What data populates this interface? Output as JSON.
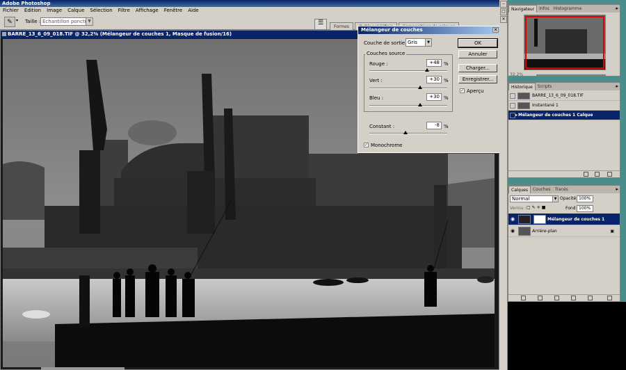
{
  "app": {
    "title": "Adobe Photoshop"
  },
  "menu": [
    "Fichier",
    "Edition",
    "Image",
    "Calque",
    "Sélection",
    "Filtre",
    "Affichage",
    "Fenêtre",
    "Aide"
  ],
  "options": {
    "size_label": "Taille :",
    "size_value": "Echantillon ponctuel"
  },
  "wells": {
    "tabs": [
      "Formes",
      "Outils prédéfinis",
      "Compositions de calques"
    ]
  },
  "document": {
    "title": "BARRE_13_6_09_018.TIF @ 32,2% (Mélangeur de couches 1, Masque de fusion/16)"
  },
  "dialog": {
    "title": "Mélangeur de couches",
    "output_label": "Couche de sortie :",
    "output_value": "Gris",
    "sources_label": "Couches source",
    "sources": [
      {
        "label": "Rouge :",
        "value": "+48",
        "unit": "%",
        "level": 0.74
      },
      {
        "label": "Vert :",
        "value": "+30",
        "unit": "%",
        "level": 0.65
      },
      {
        "label": "Bleu :",
        "value": "+30",
        "unit": "%",
        "level": 0.65
      }
    ],
    "constant": {
      "label": "Constant :",
      "value": "-8",
      "unit": "%",
      "level": 0.46
    },
    "mono_label": "Monochrome",
    "mono_checked": true,
    "buttons": {
      "ok": "OK",
      "cancel": "Annuler",
      "load": "Charger...",
      "save": "Enregistrer..."
    },
    "preview_label": "Aperçu",
    "preview_checked": true
  },
  "navigator": {
    "tabs": [
      "Navigateur",
      "Infos",
      "Histogramme"
    ],
    "zoom": "32,2%"
  },
  "history": {
    "tabs": [
      "Historique",
      "Scripts"
    ],
    "items": [
      {
        "label": "BARRE_13_6_09_018.TIF",
        "selected": false
      },
      {
        "label": "Instantané 1",
        "selected": false
      },
      {
        "label": "Mélangeur de couches 1 Calque",
        "selected": true
      }
    ]
  },
  "layers": {
    "tabs": [
      "Calques",
      "Couches",
      "Tracés"
    ],
    "blend_mode": "Normal",
    "opacity_label": "Opacité:",
    "opacity_value": "100%",
    "lock_label": "Verrou :",
    "fill_label": "Fond :",
    "fill_value": "100%",
    "items": [
      {
        "label": "Mélangeur de couches 1",
        "selected": true
      },
      {
        "label": "Arrière-plan",
        "selected": false
      }
    ]
  },
  "colors": {
    "titlebar": "#0a246a",
    "chrome": "#d4d0c8",
    "desktop": "#4b8d8b",
    "nav_frame": "#e00000"
  }
}
